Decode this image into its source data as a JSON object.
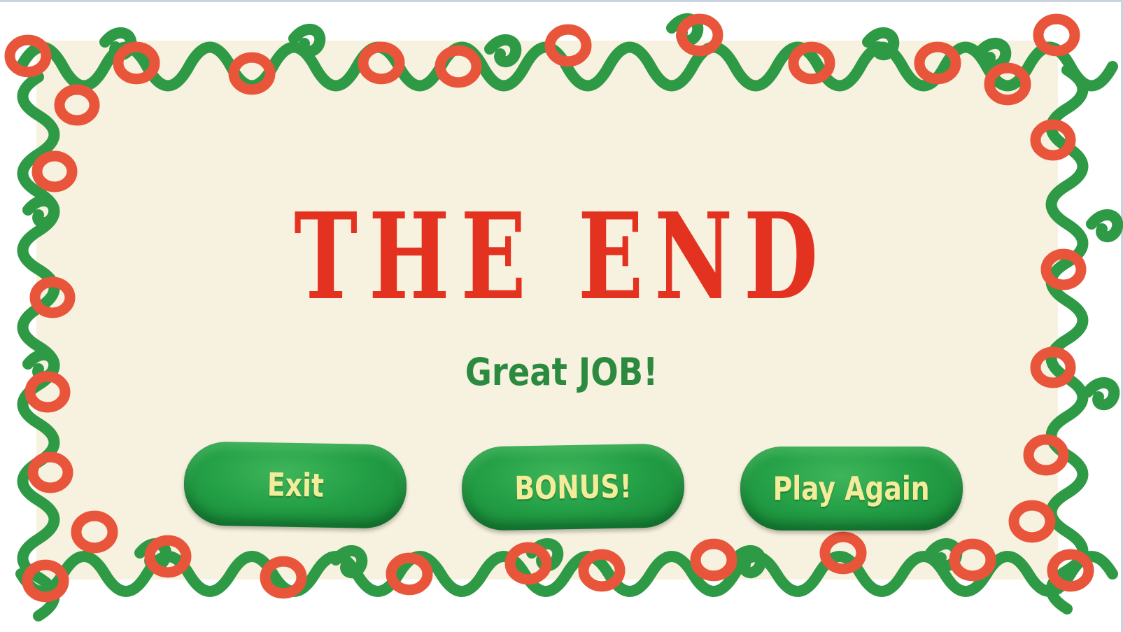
{
  "screen": {
    "title": "THE END",
    "subtitle": "Great JOB!",
    "colors": {
      "title": "#e3321f",
      "subtitle": "#2c8a3f",
      "button_fill": "#24a047",
      "button_text": "#f4ec9a",
      "panel": "#f7f1df",
      "clay_red": "#e8553a",
      "clay_green": "#2e9a45"
    }
  },
  "buttons": {
    "exit_label": "Exit",
    "bonus_label": "BONUS!",
    "play_again_label": "Play Again"
  }
}
